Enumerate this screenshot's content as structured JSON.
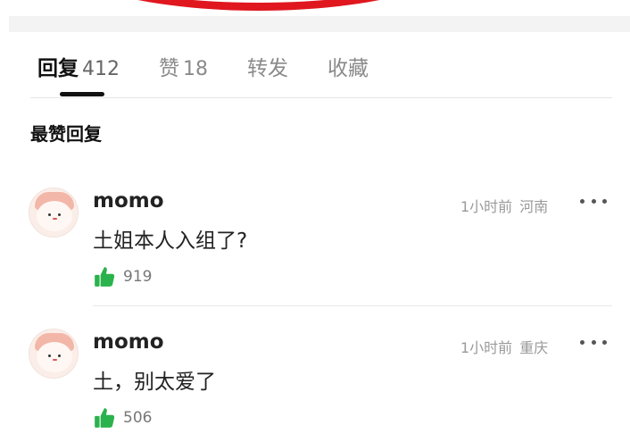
{
  "tabs": [
    {
      "label": "回复",
      "count": "412"
    },
    {
      "label": "赞",
      "count": "18"
    },
    {
      "label": "转发",
      "count": ""
    },
    {
      "label": "收藏",
      "count": ""
    }
  ],
  "section_title": "最赞回复",
  "comments": [
    {
      "user": "momo",
      "time": "1小时前",
      "location": "河南",
      "text": "土姐本人入组了?",
      "likes": "919"
    },
    {
      "user": "momo",
      "time": "1小时前",
      "location": "重庆",
      "text": "土，别太爱了",
      "likes": "506"
    }
  ],
  "colors": {
    "accent": "#e0171f",
    "like": "#2bb24c"
  },
  "icons": {
    "more": "more-horizontal-icon",
    "like": "thumbs-up-icon"
  }
}
